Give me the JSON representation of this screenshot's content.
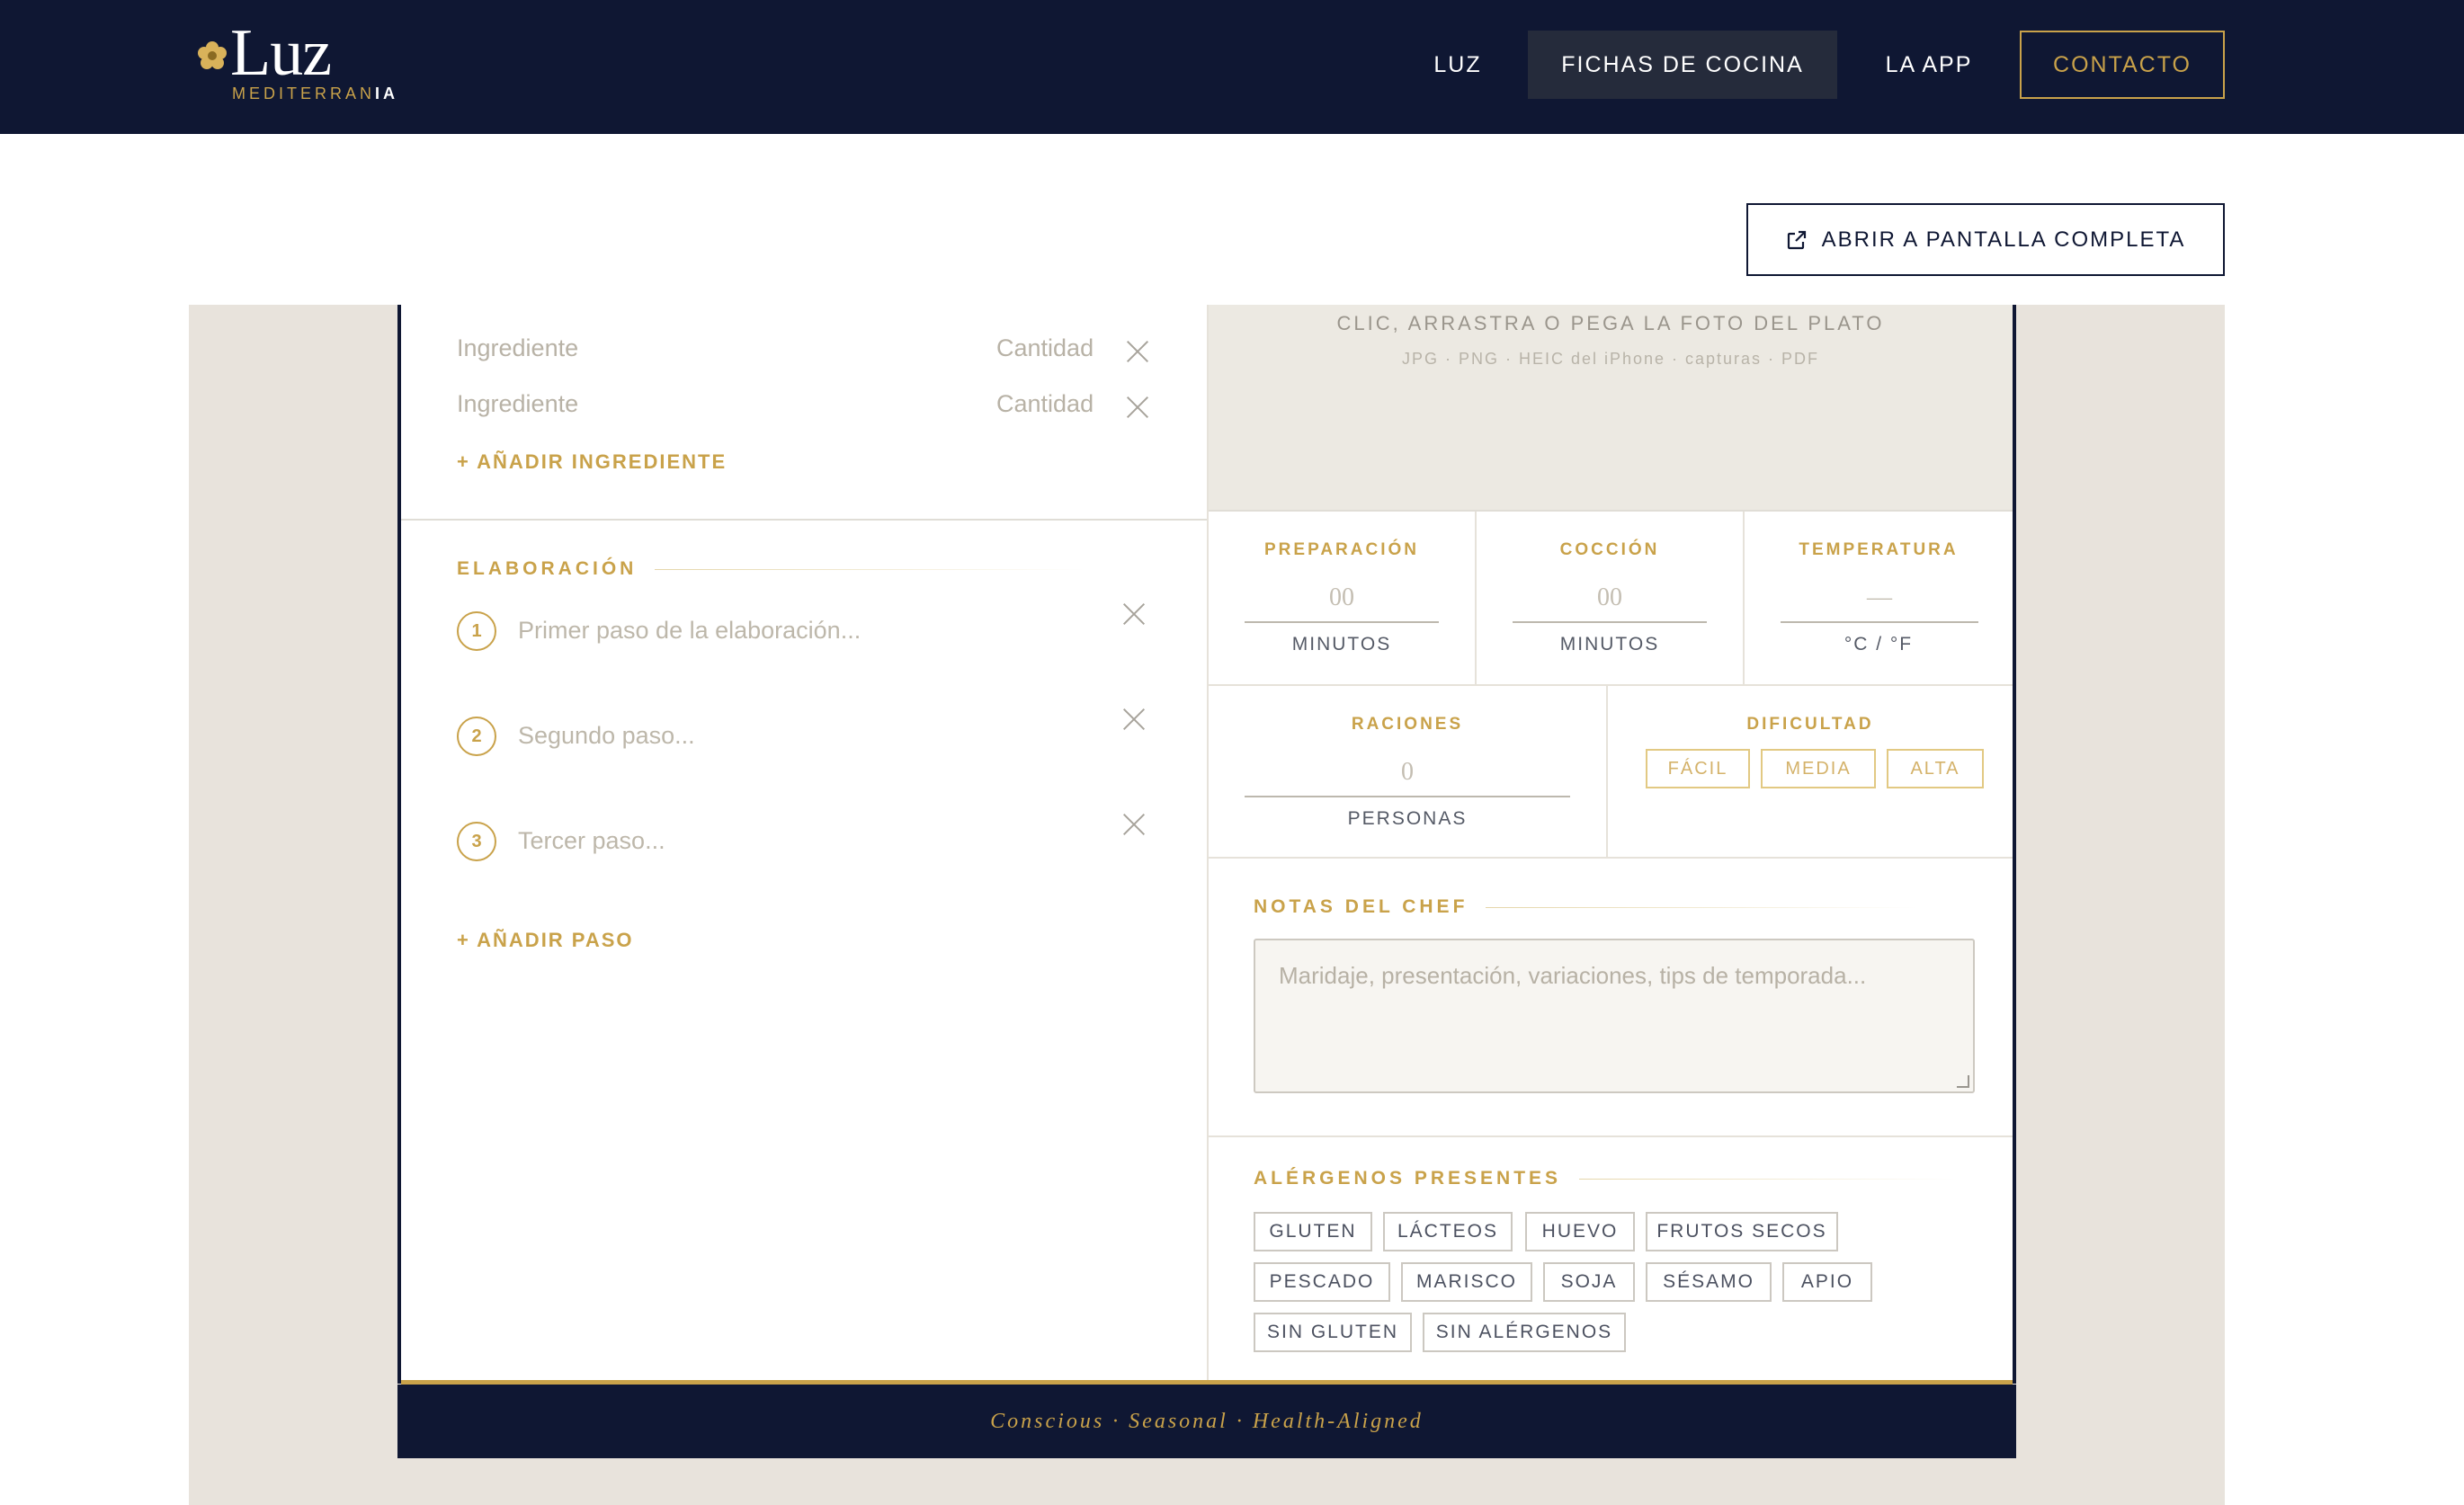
{
  "brand": {
    "name": "Luz",
    "sub_prefix": "MEDITERRAN",
    "sub_suffix": "IA"
  },
  "nav": {
    "luz": "LUZ",
    "fichas": "FICHAS DE COCINA",
    "app": "LA APP",
    "contacto": "CONTACTO"
  },
  "fullscreen_button": "ABRIR A PANTALLA COMPLETA",
  "ingredients": {
    "rows": [
      {
        "name_placeholder": "Ingrediente",
        "qty_placeholder": "Cantidad"
      },
      {
        "name_placeholder": "Ingrediente",
        "qty_placeholder": "Cantidad"
      }
    ],
    "add_label": "+ AÑADIR INGREDIENTE"
  },
  "elaboracion": {
    "title": "ELABORACIÓN",
    "steps": [
      {
        "number": "1",
        "placeholder": "Primer paso de la elaboración..."
      },
      {
        "number": "2",
        "placeholder": "Segundo paso..."
      },
      {
        "number": "3",
        "placeholder": "Tercer paso..."
      }
    ],
    "add_label": "+ AÑADIR PASO"
  },
  "photo": {
    "label": "CLIC, ARRASTRA O PEGA LA FOTO DEL PLATO",
    "formats": "JPG · PNG · HEIC del iPhone · capturas · PDF"
  },
  "stats": {
    "preparacion": {
      "label": "PREPARACIÓN",
      "placeholder": "00",
      "unit": "MINUTOS"
    },
    "coccion": {
      "label": "COCCIÓN",
      "placeholder": "00",
      "unit": "MINUTOS"
    },
    "temperatura": {
      "label": "TEMPERATURA",
      "placeholder": "—",
      "unit": "°C / °F"
    },
    "raciones": {
      "label": "RACIONES",
      "placeholder": "0",
      "unit": "PERSONAS"
    },
    "dificultad": {
      "label": "DIFICULTAD",
      "options": [
        "FÁCIL",
        "MEDIA",
        "ALTA"
      ]
    }
  },
  "notas": {
    "title": "NOTAS DEL CHEF",
    "placeholder": "Maridaje, presentación, variaciones, tips de temporada..."
  },
  "alergenos": {
    "title": "ALÉRGENOS PRESENTES",
    "items": [
      "GLUTEN",
      "LÁCTEOS",
      "HUEVO",
      "FRUTOS SECOS",
      "PESCADO",
      "MARISCO",
      "SOJA",
      "SÉSAMO",
      "APIO",
      "SIN GLUTEN",
      "SIN ALÉRGENOS"
    ]
  },
  "footer": "Conscious · Seasonal · Health-Aligned",
  "colors": {
    "navy": "#0f1733",
    "gold": "#c9a24a",
    "canvas": "#e8e3dc"
  }
}
